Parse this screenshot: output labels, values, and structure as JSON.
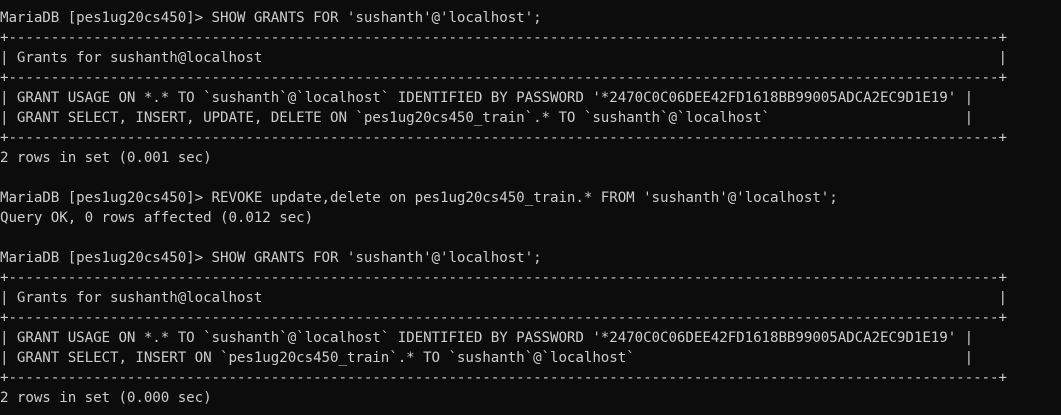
{
  "terminal": {
    "lines": [
      "MariaDB [pes1ug20cs450]> SHOW GRANTS FOR 'sushanth'@'localhost';",
      "+---------------------------------------------------------------------------------------------------------------------+",
      "| Grants for sushanth@localhost                                                                                       |",
      "+---------------------------------------------------------------------------------------------------------------------+",
      "| GRANT USAGE ON *.* TO `sushanth`@`localhost` IDENTIFIED BY PASSWORD '*2470C0C06DEE42FD1618BB99005ADCA2EC9D1E19' |",
      "| GRANT SELECT, INSERT, UPDATE, DELETE ON `pes1ug20cs450_train`.* TO `sushanth`@`localhost`                       |",
      "+---------------------------------------------------------------------------------------------------------------------+",
      "2 rows in set (0.001 sec)",
      "",
      "MariaDB [pes1ug20cs450]> REVOKE update,delete on pes1ug20cs450_train.* FROM 'sushanth'@'localhost';",
      "Query OK, 0 rows affected (0.012 sec)",
      "",
      "MariaDB [pes1ug20cs450]> SHOW GRANTS FOR 'sushanth'@'localhost';",
      "+---------------------------------------------------------------------------------------------------------------------+",
      "| Grants for sushanth@localhost                                                                                       |",
      "+---------------------------------------------------------------------------------------------------------------------+",
      "| GRANT USAGE ON *.* TO `sushanth`@`localhost` IDENTIFIED BY PASSWORD '*2470C0C06DEE42FD1618BB99005ADCA2EC9D1E19' |",
      "| GRANT SELECT, INSERT ON `pes1ug20cs450_train`.* TO `sushanth`@`localhost`                                       |",
      "+---------------------------------------------------------------------------------------------------------------------+",
      "2 rows in set (0.000 sec)"
    ]
  }
}
